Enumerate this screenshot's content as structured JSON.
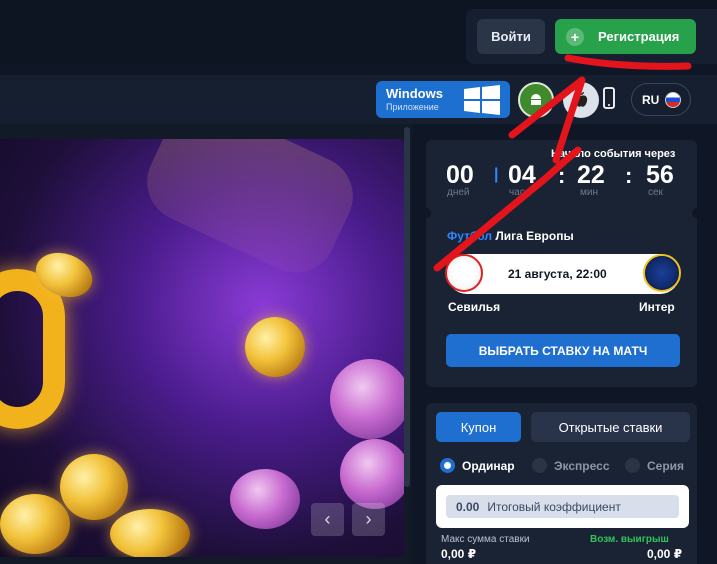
{
  "auth": {
    "login_label": "Войти",
    "register_label": "Регистрация"
  },
  "header": {
    "app_title": "Windows",
    "app_subtitle": "Приложение",
    "lang": "RU"
  },
  "event": {
    "starts_in_label": "Начало события через",
    "countdown": [
      {
        "value": "00",
        "unit": "дней"
      },
      {
        "value": "04",
        "unit": "часа"
      },
      {
        "value": "22",
        "unit": "мин"
      },
      {
        "value": "56",
        "unit": "сек"
      }
    ],
    "sport": "Футбол",
    "league": "Лига Европы",
    "date": "21 августа, 22:00",
    "home_team": "Севилья",
    "away_team": "Интер",
    "choose_bet_label": "ВЫБРАТЬ СТАВКУ НА МАТЧ"
  },
  "coupon": {
    "tabs": [
      "Купон",
      "Открытые ставки"
    ],
    "bet_types": [
      "Ординар",
      "Экспресс",
      "Серия"
    ],
    "total_coef_value": "0.00",
    "total_coef_label": "Итоговый коэффициент",
    "max_stake_label": "Макс сумма ставки",
    "max_stake_value": "0,00 ₽",
    "possible_win_label": "Возм. выигрыш",
    "possible_win_value": "0,00 ₽"
  },
  "colors": {
    "accent_blue": "#1f6fd0",
    "register_green": "#27a24a",
    "annotation_red": "#e3141b",
    "background": "#0f1726"
  }
}
